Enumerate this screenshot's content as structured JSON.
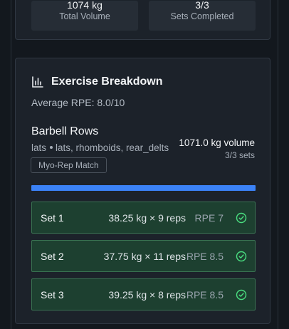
{
  "summary": {
    "total_volume_value": "1074 kg",
    "total_volume_label": "Total Volume",
    "sets_completed_value": "3/3",
    "sets_completed_label": "Sets Completed"
  },
  "breakdown": {
    "title": "Exercise Breakdown",
    "average_rpe": "Average RPE: 8.0/10",
    "exercise": {
      "name": "Barbell Rows",
      "primary_muscle": "lats",
      "muscles": "lats, rhomboids, rear_delts",
      "technique_badge": "Myo-Rep Match",
      "volume": "1071.0 kg volume",
      "sets_summary": "3/3 sets",
      "progress_percent": 100
    },
    "sets": [
      {
        "label": "Set 1",
        "detail": "38.25 kg × 9 reps",
        "rpe": "RPE 7",
        "completed": true
      },
      {
        "label": "Set 2",
        "detail": "37.75 kg × 11 reps",
        "rpe": "RPE 8.5",
        "completed": true
      },
      {
        "label": "Set 3",
        "detail": "39.25 kg × 8 reps",
        "rpe": "RPE 8.5",
        "completed": true
      }
    ]
  },
  "colors": {
    "accent": "#3b82f6",
    "completed_bg": "#1d4030",
    "completed_border": "#3a7352",
    "check": "#4ade80"
  }
}
